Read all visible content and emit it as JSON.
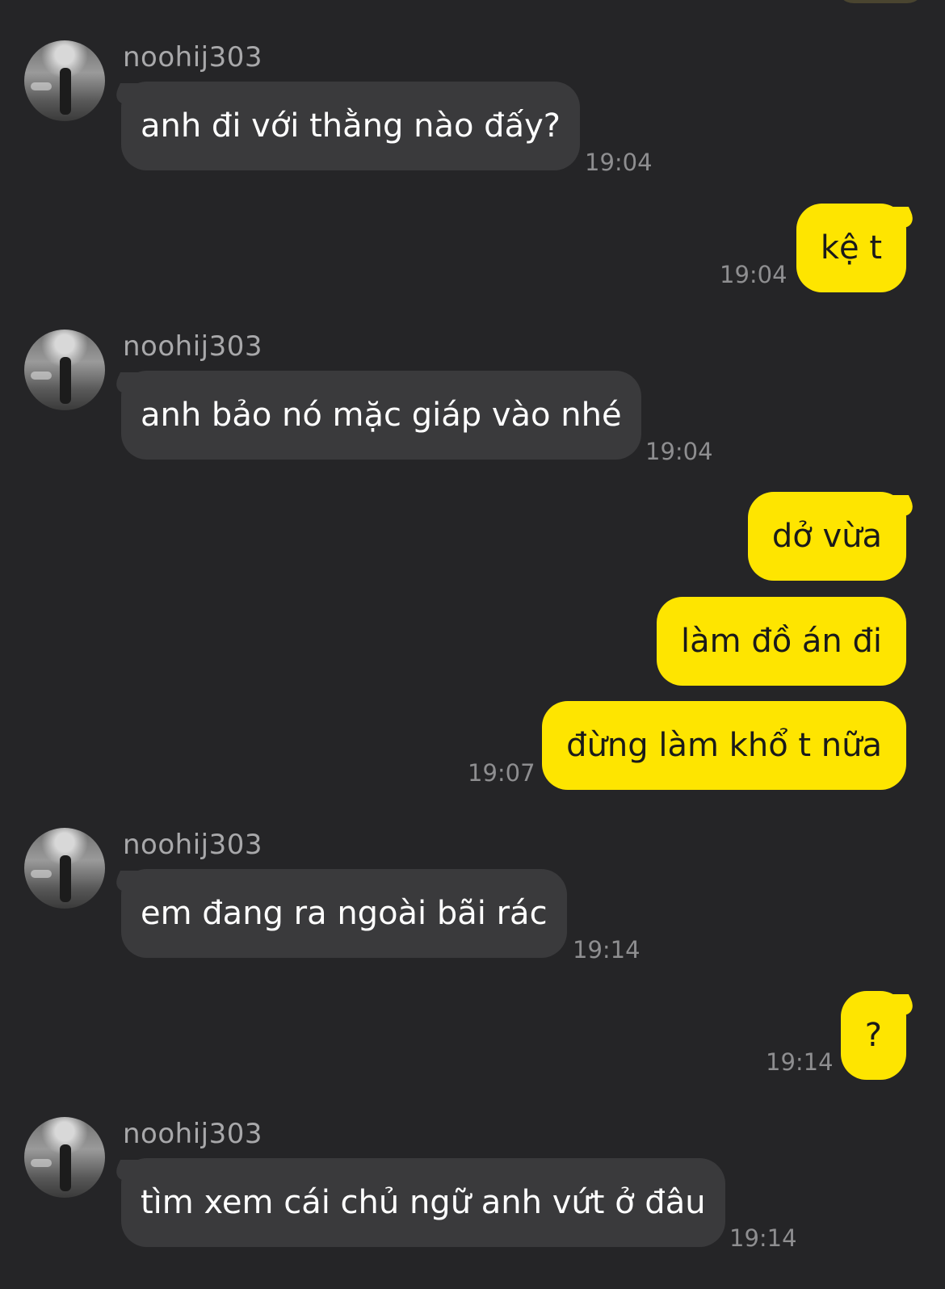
{
  "colors": {
    "background": "#252527",
    "incoming_bubble": "#3a3a3c",
    "outgoing_bubble": "#fee500",
    "timestamp": "#8e8e90"
  },
  "messages": [
    {
      "direction": "incoming",
      "sender": "noohij303",
      "text": "anh đi với thằng nào đấy?",
      "time": "19:04"
    },
    {
      "direction": "outgoing",
      "text": "kệ t",
      "time": "19:04"
    },
    {
      "direction": "incoming",
      "sender": "noohij303",
      "text": "anh bảo nó mặc giáp vào nhé",
      "time": "19:04"
    },
    {
      "direction": "outgoing",
      "text": "dở vừa",
      "time": ""
    },
    {
      "direction": "outgoing",
      "text": "làm đồ án đi",
      "time": ""
    },
    {
      "direction": "outgoing",
      "text": "đừng làm khổ t nữa",
      "time": "19:07"
    },
    {
      "direction": "incoming",
      "sender": "noohij303",
      "text": "em đang ra ngoài bãi rác",
      "time": "19:14"
    },
    {
      "direction": "outgoing",
      "text": "?",
      "time": "19:14"
    },
    {
      "direction": "incoming",
      "sender": "noohij303",
      "text": "tìm xem cái chủ ngữ anh vứt ở đâu",
      "time": "19:14"
    }
  ]
}
